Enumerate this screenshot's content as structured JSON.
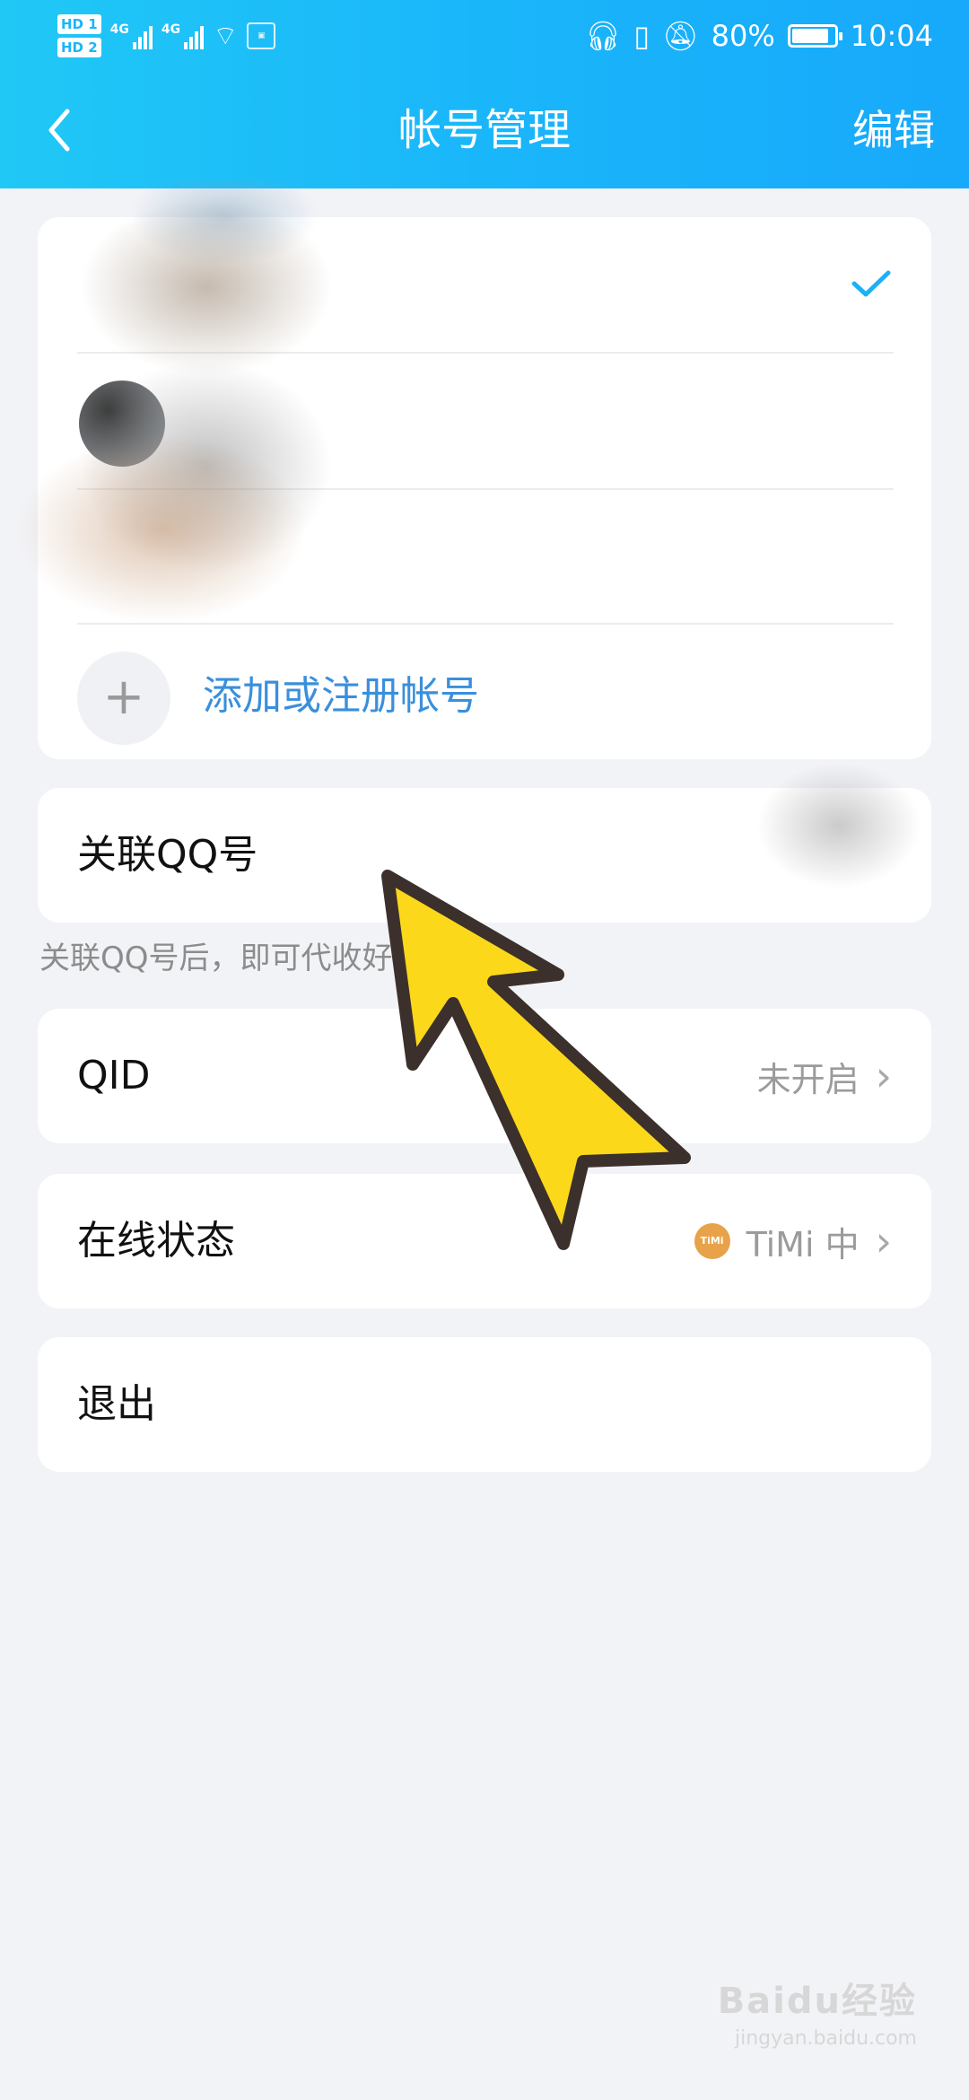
{
  "status_bar": {
    "hd1": "HD 1",
    "hd2": "HD 2",
    "network1": "4G",
    "network2": "4G",
    "battery": "80%",
    "time": "10:04"
  },
  "header": {
    "title": "帐号管理",
    "edit_label": "编辑"
  },
  "accounts": {
    "add_label": "添加或注册帐号"
  },
  "link_qq": {
    "label": "关联QQ号",
    "hint": "关联QQ号后，即可代收好友消息。"
  },
  "qid": {
    "label": "QID",
    "value": "未开启"
  },
  "online_status": {
    "label": "在线状态",
    "badge": "TiMi",
    "value": "TiMi 中"
  },
  "logout": {
    "label": "退出"
  },
  "watermark": {
    "brand": "Baidu经验",
    "site": "jingyan.baidu.com"
  },
  "colors": {
    "header_start": "#20c8f6",
    "header_end": "#17a9fb",
    "accent_link": "#3a8fdc",
    "check": "#1db0f6",
    "arrow_fill": "#fcd81b",
    "arrow_stroke": "#3b302c"
  }
}
